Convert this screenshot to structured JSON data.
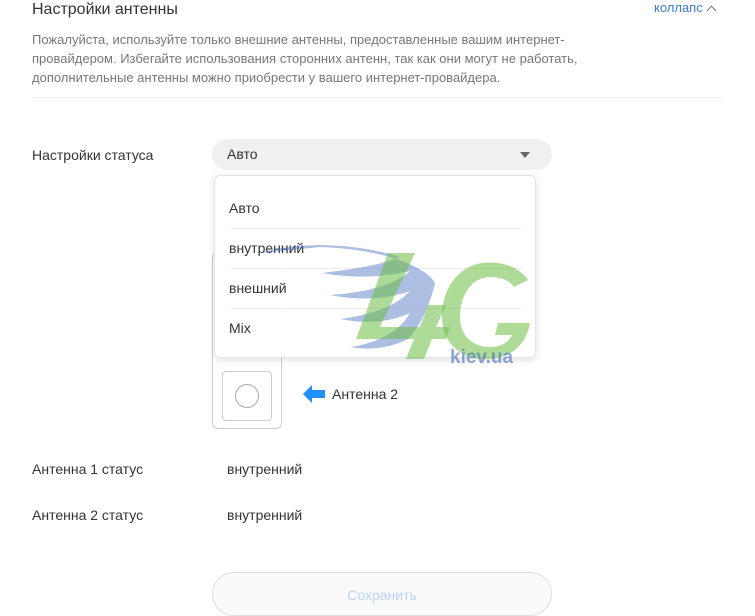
{
  "header": {
    "title": "Настройки антенны",
    "collapse_label": "коллапс",
    "collapse_icon": "chevron-up-icon"
  },
  "description": "Пожалуйста, используйте только внешние антенны, предоставленные вашим интернет-провайдером. Избегайте использования сторонних антенн, так как они могут не работать, дополнительные антенны можно приобрести у вашего интернет-провайдера.",
  "status_settings": {
    "label": "Настройки статуса",
    "selected": "Авто",
    "options": [
      "Авто",
      "внутренний",
      "внешний",
      "Mix"
    ]
  },
  "diagram": {
    "antenna2_label": "Антенна 2",
    "arrow_color": "#1e90ff"
  },
  "antenna_status": [
    {
      "label": "Антенна 1 статус",
      "value": "внутренний"
    },
    {
      "label": "Антенна 2 статус",
      "value": "внутренний"
    }
  ],
  "actions": {
    "save_label": "Сохранить"
  },
  "watermark": {
    "logo_text": "4G",
    "site_text": "kiev.ua"
  },
  "colors": {
    "accent": "#3b7bd4",
    "save_text_disabled": "#b9d3f3"
  }
}
